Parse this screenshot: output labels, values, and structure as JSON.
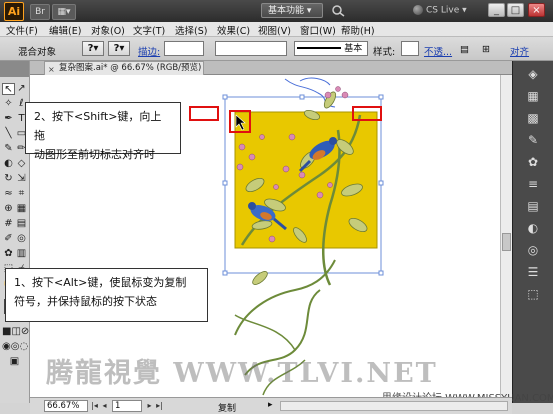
{
  "app": {
    "logo_text": "Ai",
    "workspace": "基本功能 ▾",
    "cs_live": "CS Live ▾"
  },
  "window_buttons": [
    "_",
    "□",
    "×"
  ],
  "menu": [
    "文件(F)",
    "编辑(E)",
    "对象(O)",
    "文字(T)",
    "选择(S)",
    "效果(C)",
    "视图(V)",
    "窗口(W)",
    "帮助(H)"
  ],
  "control_bar": {
    "mode_label": "混合对象",
    "fill_symbol": "?",
    "stroke_symbol": "?",
    "stroke_label": "描边:",
    "stroke_value": "",
    "stroke_style": "基本",
    "style_label": "样式:",
    "opacity_link": "不透...",
    "align_link": "对齐"
  },
  "document_tab": {
    "title": "复杂图案.ai* @ 66.67% (RGB/预览)",
    "close": "×"
  },
  "callouts": {
    "step1_line1": "1、按下<Alt>键，使鼠标变为复制",
    "step1_line2": "符号，并保持鼠标的按下状态",
    "step2_line1": "2、按下<Shift>键，向上拖",
    "step2_line2": "动图形至前切标志对齐时"
  },
  "status_bar": {
    "zoom": "66.67%",
    "page": "1",
    "tool_name": "复制"
  },
  "watermark": {
    "main": "腾龍視覺 WWW.TLVI.NET",
    "site": "思缘设计论坛 WWW.MISSYUAN.COM"
  },
  "colors": {
    "artboard_fill": "#e8c800",
    "highlight_red": "#e01010",
    "selection_blue": "#6c8fd8"
  },
  "tools": [
    "selection-arrow",
    "direct-select",
    "magic-wand",
    "pen",
    "type",
    "line",
    "rect",
    "brush",
    "pencil",
    "blob",
    "eraser",
    "rotate",
    "scale",
    "warp",
    "width",
    "free-transform",
    "shape-builder",
    "perspective",
    "mesh",
    "gradient",
    "eyedropper",
    "blend",
    "symbol-spray",
    "graph",
    "artboard",
    "slice",
    "hand",
    "zoom"
  ]
}
